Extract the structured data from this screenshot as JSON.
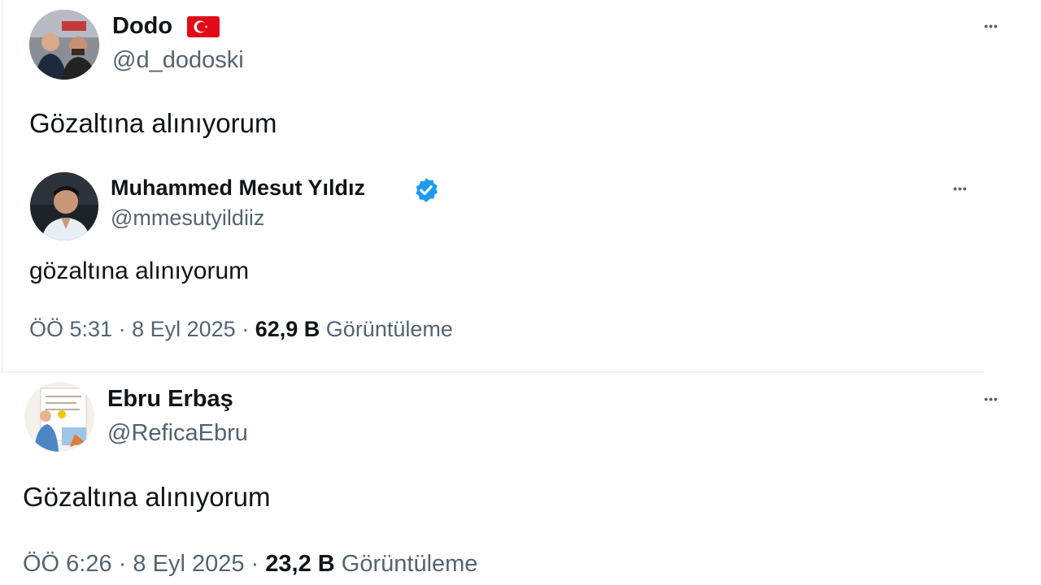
{
  "tweet1": {
    "name": "Dodo",
    "flag_icon": "turkey-flag-icon",
    "handle": "@d_dodoski",
    "text": "Gözaltına alınıyorum",
    "more": "•••"
  },
  "tweet2": {
    "name": "Muhammed Mesut Yıldız",
    "verified_icon": "verified-badge-icon",
    "handle": "@mmesutyildiiz",
    "text": "gözaltına alınıyorum",
    "time": "ÖÖ 5:31",
    "sep1": "·",
    "date": "8 Eyl 2025",
    "sep2": "·",
    "views": "62,9 B",
    "views_label": "Görüntüleme",
    "more": "•••"
  },
  "tweet3": {
    "name": "Ebru Erbaş",
    "handle": "@ReficaEbru",
    "text": "Gözaltına alınıyorum",
    "time": "ÖÖ 6:26",
    "sep1": "·",
    "date": "8 Eyl 2025",
    "sep2": "·",
    "views": "23,2 B",
    "views_label": "Görüntüleme",
    "more": "•••"
  },
  "colors": {
    "text": "#0f1419",
    "secondary": "#536471",
    "verified": "#1d9bf0",
    "flag": "#e30a17"
  }
}
